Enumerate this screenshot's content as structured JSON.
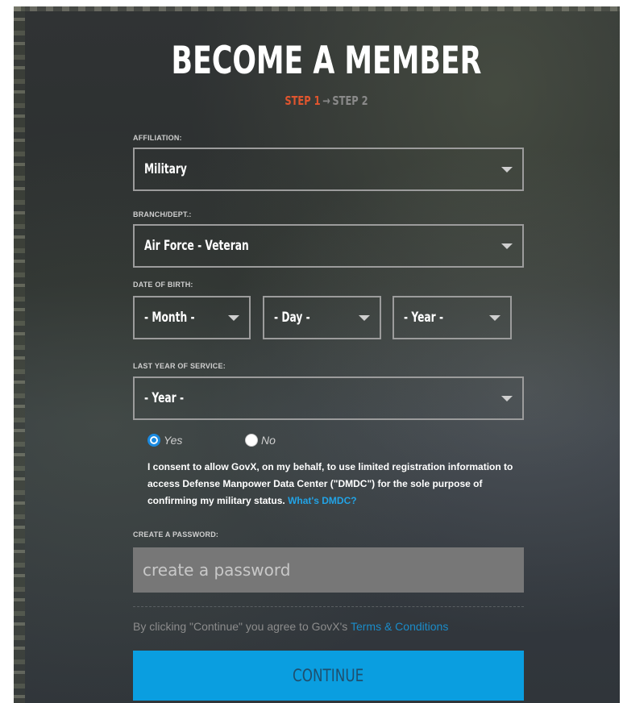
{
  "form": {
    "title": "BECOME A MEMBER",
    "steps": {
      "current": "STEP 1",
      "arrow": "→",
      "next": "STEP 2"
    },
    "affiliation": {
      "label": "AFFILIATION:",
      "value": "Military"
    },
    "branch": {
      "label": "BRANCH/DEPT.:",
      "value": "Air Force - Veteran"
    },
    "dob": {
      "label": "DATE OF BIRTH:",
      "month": "- Month -",
      "day": "- Day -",
      "year": "- Year -"
    },
    "last_service": {
      "label": "LAST YEAR OF SERVICE:",
      "value": "- Year -"
    },
    "consent_choice": {
      "yes": "Yes",
      "no": "No",
      "selected": "Yes"
    },
    "consent_text": "I consent to allow GovX, on my behalf, to use limited registration information to access Defense Manpower Data Center (\"DMDC\") for the sole purpose of confirming my military status.",
    "consent_link": "What's DMDC?",
    "password": {
      "label": "CREATE A PASSWORD:",
      "placeholder": "create a password"
    },
    "terms": {
      "text": "By clicking \"Continue\" you agree to GovX's",
      "link": "Terms & Conditions"
    },
    "continue_label": "CONTINUE"
  },
  "colors": {
    "accent": "#0a9ee0",
    "step_active": "#e1552e",
    "link": "#22a3e6"
  }
}
